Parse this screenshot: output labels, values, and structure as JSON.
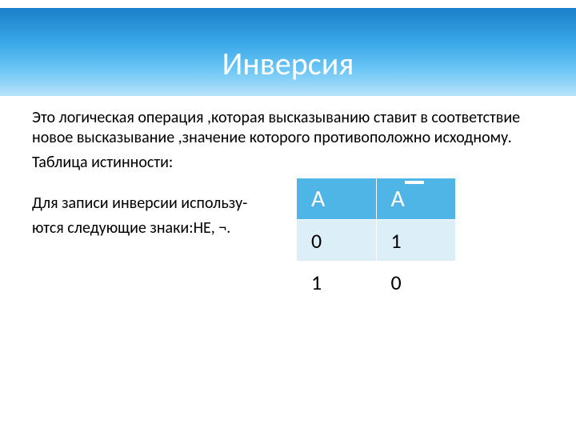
{
  "title": "Инверсия",
  "paragraphs": {
    "definition": "Это логическая операция ,которая высказыванию ставит в соответствие новое высказывание ,значение которого противоположно исходному.",
    "table_label": "Таблица истинности:",
    "notation_line1": "Для записи инверсии использу-",
    "notation_line2": "ются следующие знаки:НЕ, ¬."
  },
  "table": {
    "headers": {
      "col1": "A",
      "col2_base": "A"
    },
    "rows": [
      {
        "a": "0",
        "not_a": "1"
      },
      {
        "a": "1",
        "not_a": "0"
      }
    ]
  }
}
